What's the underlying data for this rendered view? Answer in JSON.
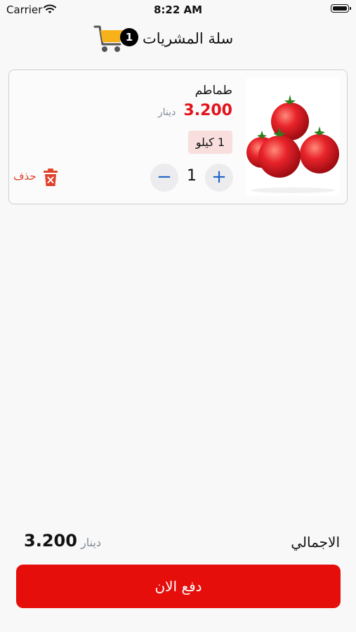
{
  "status_bar": {
    "carrier": "Carrier",
    "time": "8:22 AM"
  },
  "header": {
    "title": "سلة المشريات",
    "cart_count": "1",
    "cart_icon": "shopping-cart-icon"
  },
  "cart_items": [
    {
      "name": "طماطم",
      "price": "3.200",
      "currency": "دينار",
      "unit": "1 كيلو",
      "quantity": "1",
      "plus_symbol": "+",
      "minus_symbol": "−",
      "delete_label": "حذف"
    }
  ],
  "summary": {
    "total_label": "الاجمالي",
    "total_value": "3.200",
    "currency": "دينار"
  },
  "pay_button": {
    "label": "دفع الان"
  },
  "colors": {
    "accent": "#e50e0b",
    "price": "#e3121b",
    "stepper_icon": "#1e63c4",
    "unit_badge": "#f9dede",
    "delete": "#e0412a"
  }
}
